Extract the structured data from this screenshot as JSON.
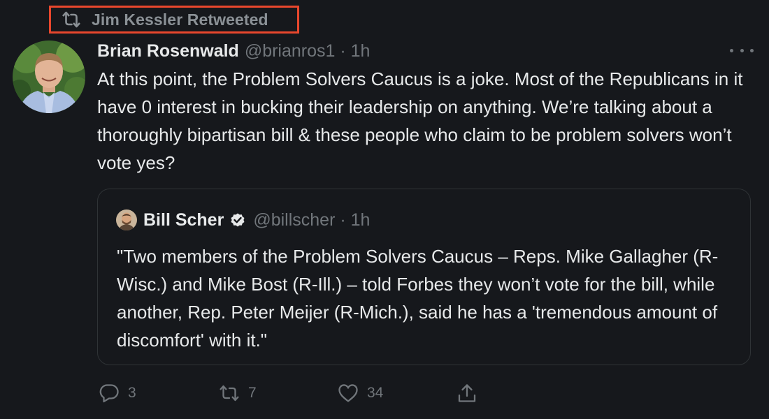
{
  "retweet_banner": {
    "text": "Jim Kessler Retweeted"
  },
  "tweet": {
    "author_name": "Brian Rosenwald",
    "author_handle_time": "@brianros1 · 1h",
    "text": "At this point, the Problem Solvers Caucus is a joke. Most of the Republicans in it have 0 interest in bucking their leadership on anything. We’re talking about a thoroughly bipartisan bill & these people who claim to be problem solvers won’t vote yes?"
  },
  "quote": {
    "author_name": "Bill Scher",
    "author_handle_time": "@billscher · 1h",
    "verified": true,
    "text": "\"Two members of the Problem Solvers Caucus – Reps. Mike Gallagher (R-Wisc.) and Mike Bost (R-Ill.) – told Forbes they won’t vote for the bill, while another, Rep. Peter Meijer (R-Mich.), said he has a 'tremendous amount of discomfort' with it.\""
  },
  "actions": {
    "replies": "3",
    "retweets": "7",
    "likes": "34"
  },
  "colors": {
    "background": "#16181c",
    "text": "#e7e9ea",
    "muted": "#71767b",
    "highlight_box": "#e8472d"
  }
}
